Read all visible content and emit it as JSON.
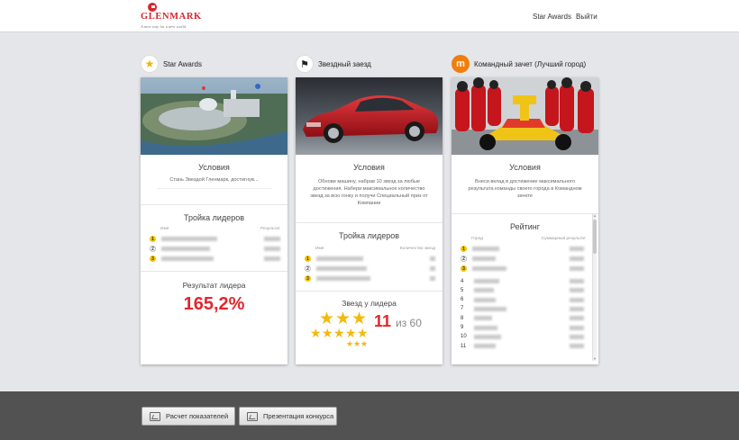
{
  "header": {
    "logo_text": "GLENMARK",
    "logo_tagline": "A new way for a new world",
    "nav_star_awards": "Star Awards",
    "nav_logout": "Выйти"
  },
  "columns": [
    {
      "title": "Star Awards",
      "icon": "star-icon",
      "conditions_title": "Условия",
      "conditions_text": "Стань Звездой Гленмарк, достигнув...",
      "leaders_title": "Тройка лидеров",
      "leaders_col_name": "Имя",
      "leaders_col_value": "Результат",
      "result_title": "Результат лидера",
      "result_value": "165,2%"
    },
    {
      "title": "Звездный заезд",
      "icon": "checkered-flag-icon",
      "conditions_title": "Условия",
      "conditions_text": "Обнови машину, набрав 10 звезд за любые достижения. Набери максимальное количество звезд за всю гонку и получи Специальный приз от Компании",
      "leaders_title": "Тройка лидеров",
      "leaders_col_name": "Имя",
      "leaders_col_value": "Количество звезд",
      "stars_title": "Звезд у лидера",
      "stars_count": "11",
      "stars_of": "из 60"
    },
    {
      "title": "Командный зачет (Лучший город)",
      "icon": "team-icon",
      "conditions_title": "Условия",
      "conditions_text": "Внеси вклад в достижение максимального результата команды своего города в Командном зачете",
      "rating_title": "Рейтинг",
      "rating_col_name": "Город",
      "rating_col_value": "Суммарный результат",
      "ranks": [
        "4",
        "5",
        "6",
        "7",
        "8",
        "9",
        "10",
        "11"
      ]
    }
  ],
  "footer": {
    "btn_calc": "Расчет показателей",
    "btn_presentation": "Презентация конкурса"
  },
  "colors": {
    "accent_red": "#e3262c",
    "gold": "#f4c400",
    "footer_bg": "#525252"
  }
}
